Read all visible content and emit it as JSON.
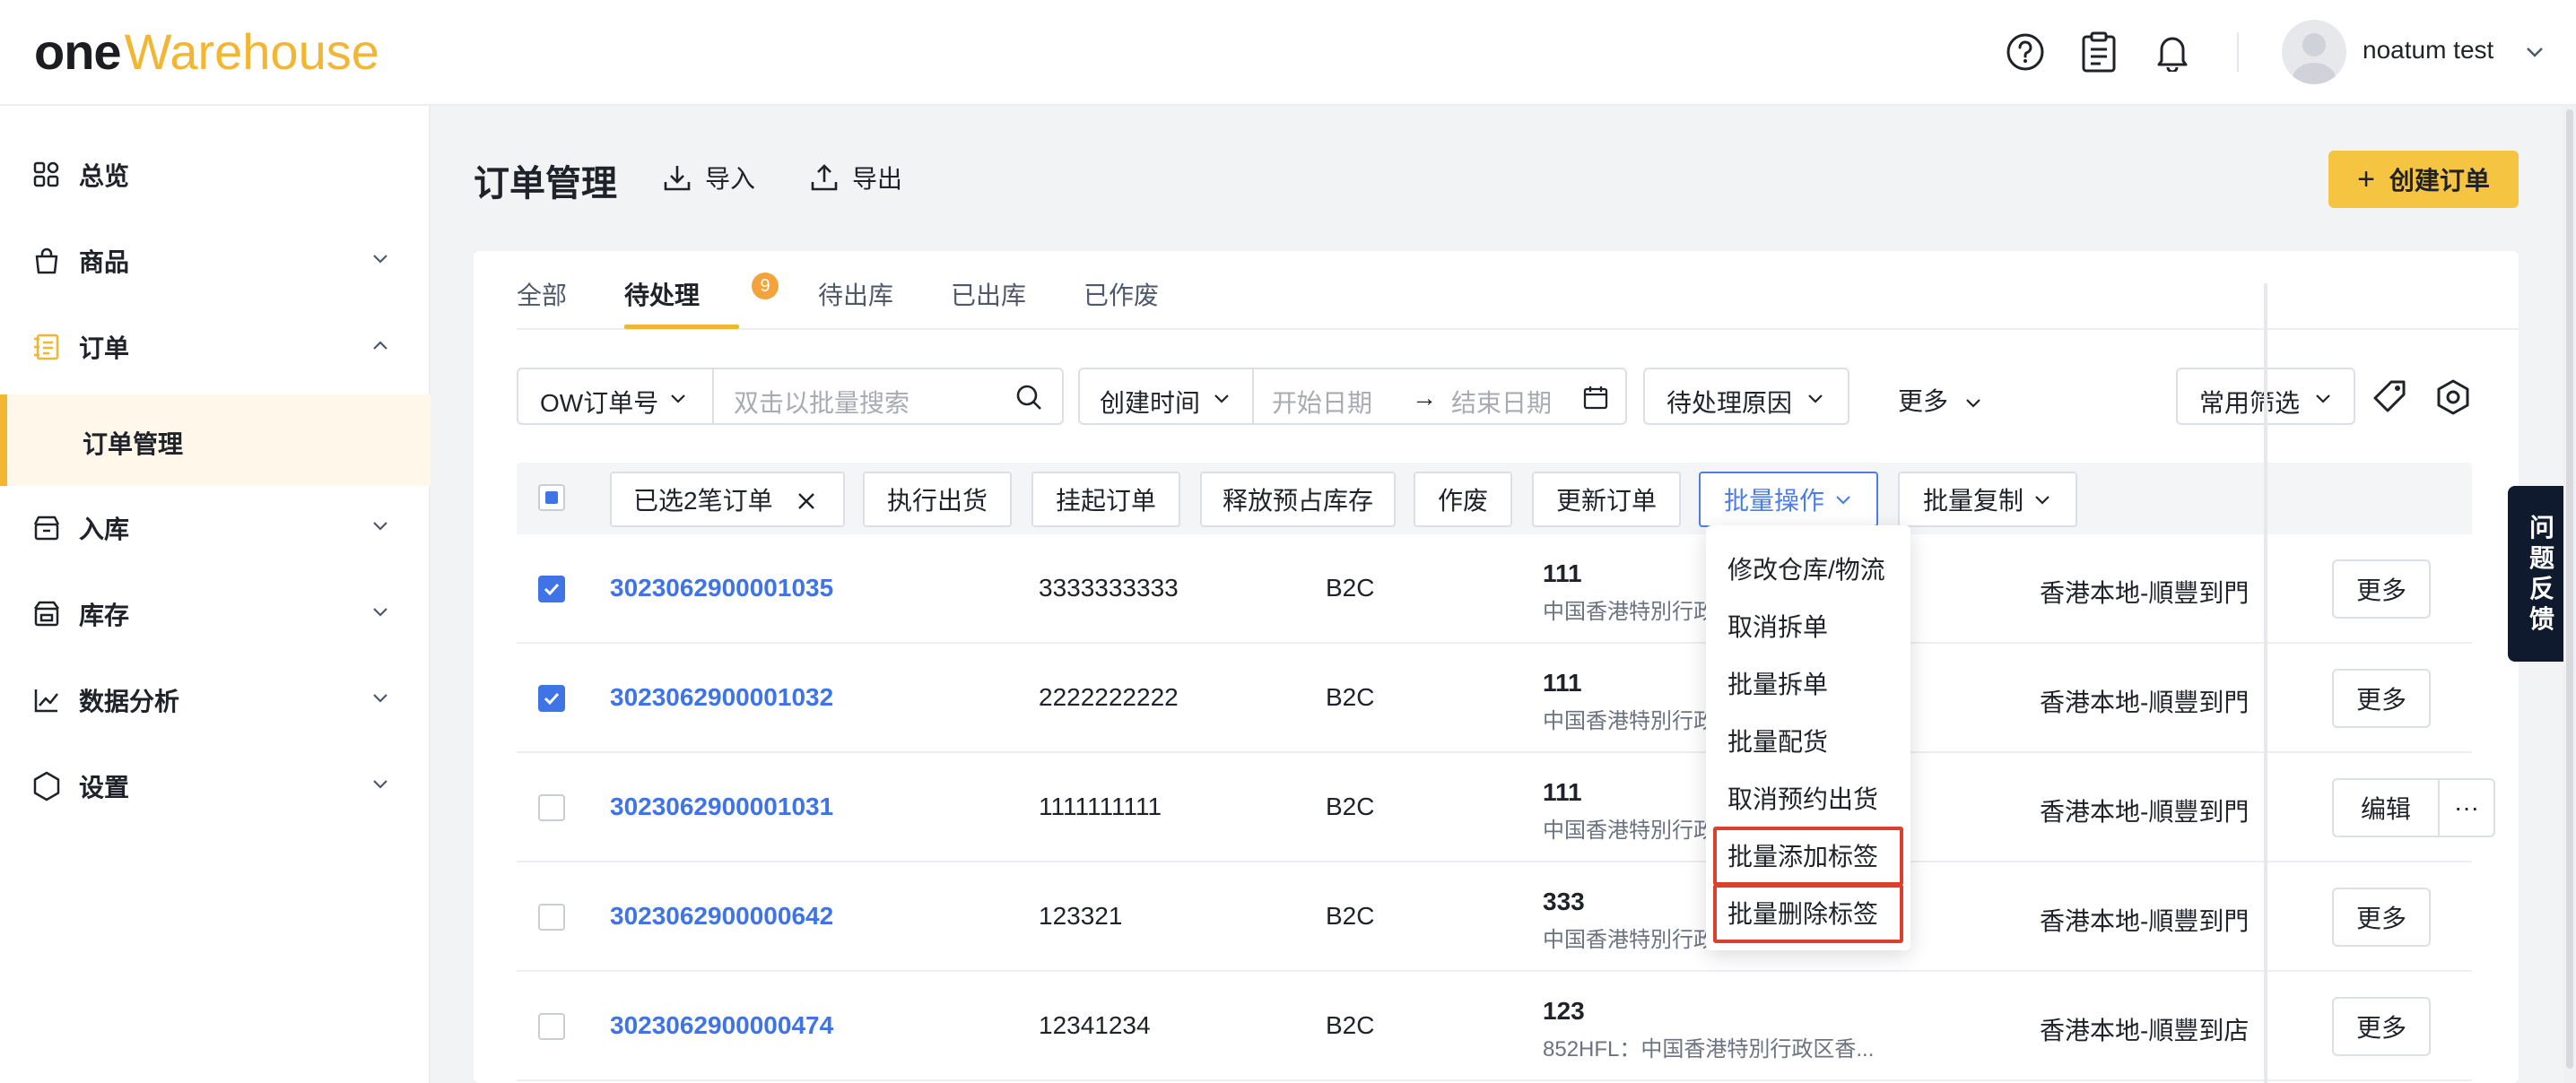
{
  "app": {
    "logo_one": "one",
    "logo_warehouse": "Warehouse"
  },
  "header": {
    "user_name": "noatum test",
    "icons": [
      "help-icon",
      "clipboard-icon",
      "bell-icon"
    ]
  },
  "sidebar": {
    "items": [
      {
        "label": "总览",
        "icon": "dashboard-icon"
      },
      {
        "label": "商品",
        "icon": "bag-icon"
      },
      {
        "label": "订单",
        "icon": "order-icon"
      },
      {
        "label": "入库",
        "icon": "inbound-icon"
      },
      {
        "label": "库存",
        "icon": "inventory-icon"
      },
      {
        "label": "数据分析",
        "icon": "analytics-icon"
      },
      {
        "label": "设置",
        "icon": "settings-hex-icon"
      }
    ],
    "sub_active": "订单管理"
  },
  "page": {
    "title": "订单管理",
    "import_label": "导入",
    "export_label": "导出",
    "create_label": "创建订单"
  },
  "tabs": [
    {
      "label": "全部"
    },
    {
      "label": "待处理",
      "badge": "9"
    },
    {
      "label": "待出库"
    },
    {
      "label": "已出库"
    },
    {
      "label": "已作废"
    }
  ],
  "filters": {
    "search_field": "OW订单号",
    "search_placeholder": "双击以批量搜索",
    "date_field": "创建时间",
    "start_placeholder": "开始日期",
    "arrow": "→",
    "end_placeholder": "结束日期",
    "reason": "待处理原因",
    "more": "更多",
    "common": "常用筛选"
  },
  "toolbar": {
    "selected": "已选2笔订单",
    "ship": "执行出货",
    "hold": "挂起订单",
    "release": "释放预占库存",
    "void": "作废",
    "update": "更新订单",
    "batch_ops": "批量操作",
    "batch_copy": "批量复制"
  },
  "rows": [
    {
      "order_no": "3023062900001035",
      "ref": "3333333333",
      "type": "B2C",
      "name": "111",
      "address": "中国香港特別行政",
      "channel": "香港本地-順豐到門",
      "action": "更多",
      "checked": true
    },
    {
      "order_no": "3023062900001032",
      "ref": "2222222222",
      "type": "B2C",
      "name": "111",
      "address": "中国香港特別行政",
      "channel": "香港本地-順豐到門",
      "action": "更多",
      "checked": true
    },
    {
      "order_no": "3023062900001031",
      "ref": "1111111111",
      "type": "B2C",
      "name": "111",
      "address": "中国香港特別行政",
      "channel": "香港本地-順豐到門",
      "action": "编辑",
      "action_more": "···",
      "checked": false
    },
    {
      "order_no": "3023062900000642",
      "ref": "123321",
      "type": "B2C",
      "name": "333",
      "address": "中国香港特別行政",
      "channel": "香港本地-順豐到門",
      "action": "更多",
      "checked": false
    },
    {
      "order_no": "3023062900000474",
      "ref": "12341234",
      "type": "B2C",
      "name": "123",
      "address": "852HFL：中国香港特別行政区香...",
      "channel": "香港本地-順豐到店",
      "action": "更多",
      "checked": false
    }
  ],
  "dropdown": {
    "items": [
      "修改仓库/物流",
      "取消拆单",
      "批量拆单",
      "批量配货",
      "取消预约出货",
      "批量添加标签",
      "批量删除标签"
    ],
    "highlight_color": "#d9412e"
  },
  "feedback": [
    "问",
    "题",
    "反",
    "馈"
  ],
  "colors": {
    "accent": "#f2b632",
    "link": "#3f74e6",
    "badge": "#f2a33c"
  }
}
